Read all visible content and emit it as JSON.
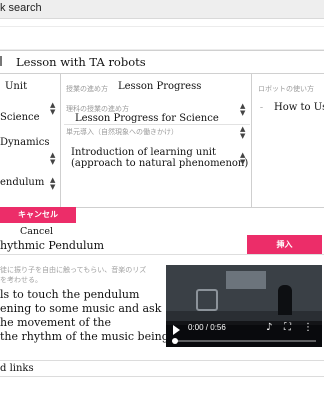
{
  "window": {
    "title": "k search"
  },
  "lesson": {
    "title": "Lesson with TA robots"
  },
  "unit_panel": {
    "header": "Unit",
    "subject": "Science",
    "unit": "Dynamics",
    "topic": "endulum"
  },
  "progress_panel": {
    "header_jp": "授業の進め方",
    "header": "Lesson Progress",
    "select1_jp": "理科の授業の進め方",
    "select1_value": "Lesson Progress for Science",
    "select2_jp": "単元導入（自然現象への働きかけ）",
    "select2_line1": "Introduction of learning  unit",
    "select2_line2": "(approach to natural  phenomenon)"
  },
  "robot_panel": {
    "header_jp": "ロボットの使い方",
    "value": "How to Use"
  },
  "actions": {
    "cancel_jp": "キャンセル",
    "cancel_en": "Cancel",
    "insert_jp": "挿入"
  },
  "item": {
    "title": "hythmic Pendulum",
    "desc_jp_line1": "徒に振り子を自由に触ってもらい、音楽のリズ",
    "desc_jp_line2": "を考わせる。",
    "desc_en_line1": "ls to touch the pendulum",
    "desc_en_line2": "ening to some music and ask",
    "desc_en_line3": "he movement  of the",
    "desc_en_line4": "the rhythm  of the music being"
  },
  "video": {
    "time": "0:00 / 0:56",
    "progress": 0.0
  },
  "footer": {
    "links_label": "d links"
  }
}
